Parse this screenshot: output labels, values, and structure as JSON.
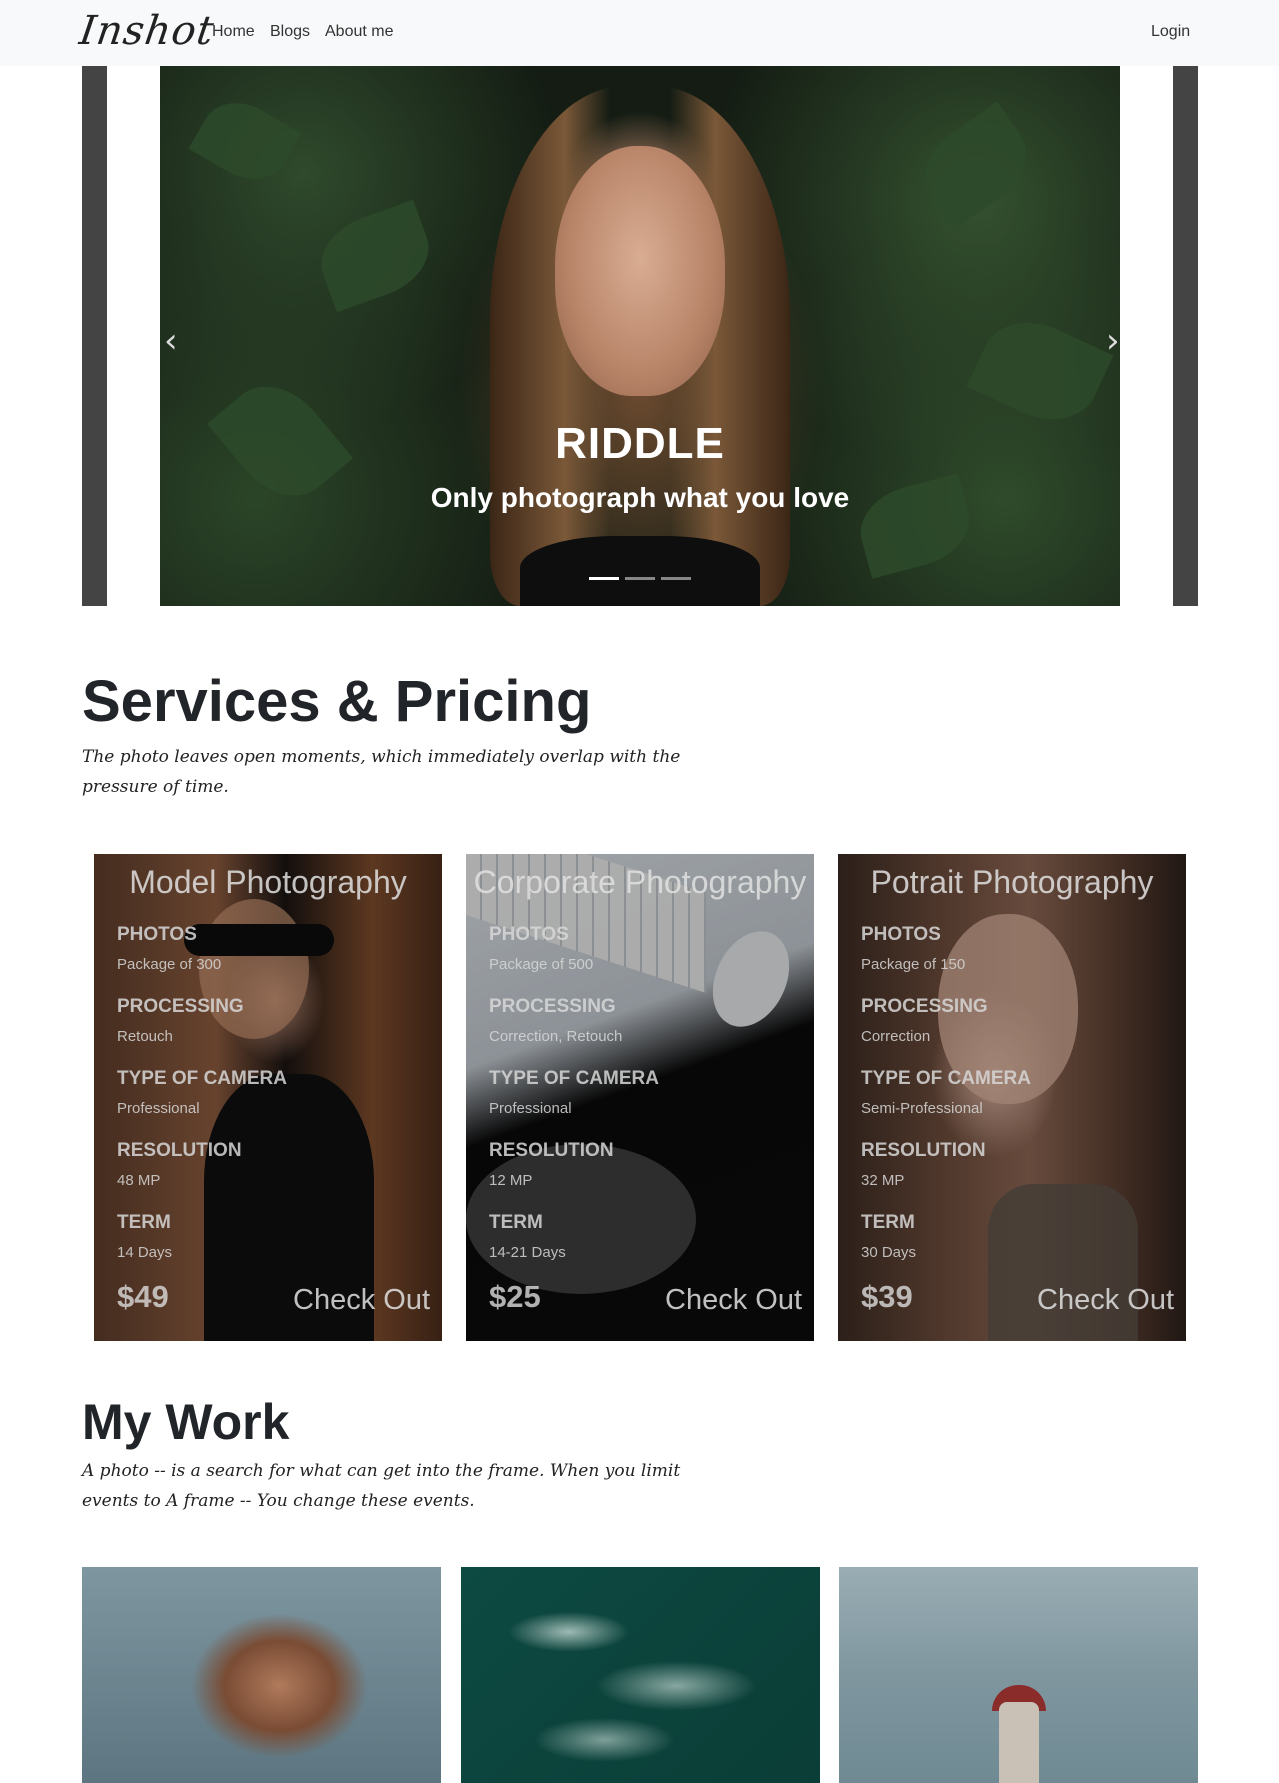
{
  "navbar": {
    "brand": "Inshot",
    "links": [
      "Home",
      "Blogs",
      "About me"
    ],
    "login": "Login"
  },
  "carousel": {
    "title": "RIDDLE",
    "subtitle": "Only photograph what you love",
    "indicator_count": 3,
    "active_index": 0
  },
  "services": {
    "title": "Services & Pricing",
    "subtitle": "The photo leaves open moments, which immediately overlap with the pressure of time.",
    "cards": [
      {
        "title": "Model Photography",
        "features": [
          {
            "label": "PHOTOS",
            "value": "Package of 300"
          },
          {
            "label": "PROCESSING",
            "value": "Retouch"
          },
          {
            "label": "TYPE OF CAMERA",
            "value": "Professional"
          },
          {
            "label": "RESOLUTION",
            "value": "48 MP"
          },
          {
            "label": "TERM",
            "value": "14 Days"
          }
        ],
        "price": "$49",
        "cta": "Check Out"
      },
      {
        "title": "Corporate Photography",
        "features": [
          {
            "label": "PHOTOS",
            "value": "Package of 500"
          },
          {
            "label": "PROCESSING",
            "value": "Correction, Retouch"
          },
          {
            "label": "TYPE OF CAMERA",
            "value": "Professional"
          },
          {
            "label": "RESOLUTION",
            "value": "12 MP"
          },
          {
            "label": "TERM",
            "value": "14-21 Days"
          }
        ],
        "price": "$25",
        "cta": "Check Out"
      },
      {
        "title": "Potrait Photography",
        "features": [
          {
            "label": "PHOTOS",
            "value": "Package of 150"
          },
          {
            "label": "PROCESSING",
            "value": "Correction"
          },
          {
            "label": "TYPE OF CAMERA",
            "value": "Semi-Professional"
          },
          {
            "label": "RESOLUTION",
            "value": "32 MP"
          },
          {
            "label": "TERM",
            "value": "30 Days"
          }
        ],
        "price": "$39",
        "cta": "Check Out"
      }
    ]
  },
  "work": {
    "title": "My Work",
    "subtitle": "A photo -- is a search for what can get into the frame. When you limit events to A frame -- You change these events."
  },
  "icons": {
    "prev": "chevron-left-icon",
    "next": "chevron-right-icon"
  },
  "colors": {
    "navbar_bg": "#f8f9fa",
    "text": "#212529",
    "carousel_side": "#444444"
  }
}
